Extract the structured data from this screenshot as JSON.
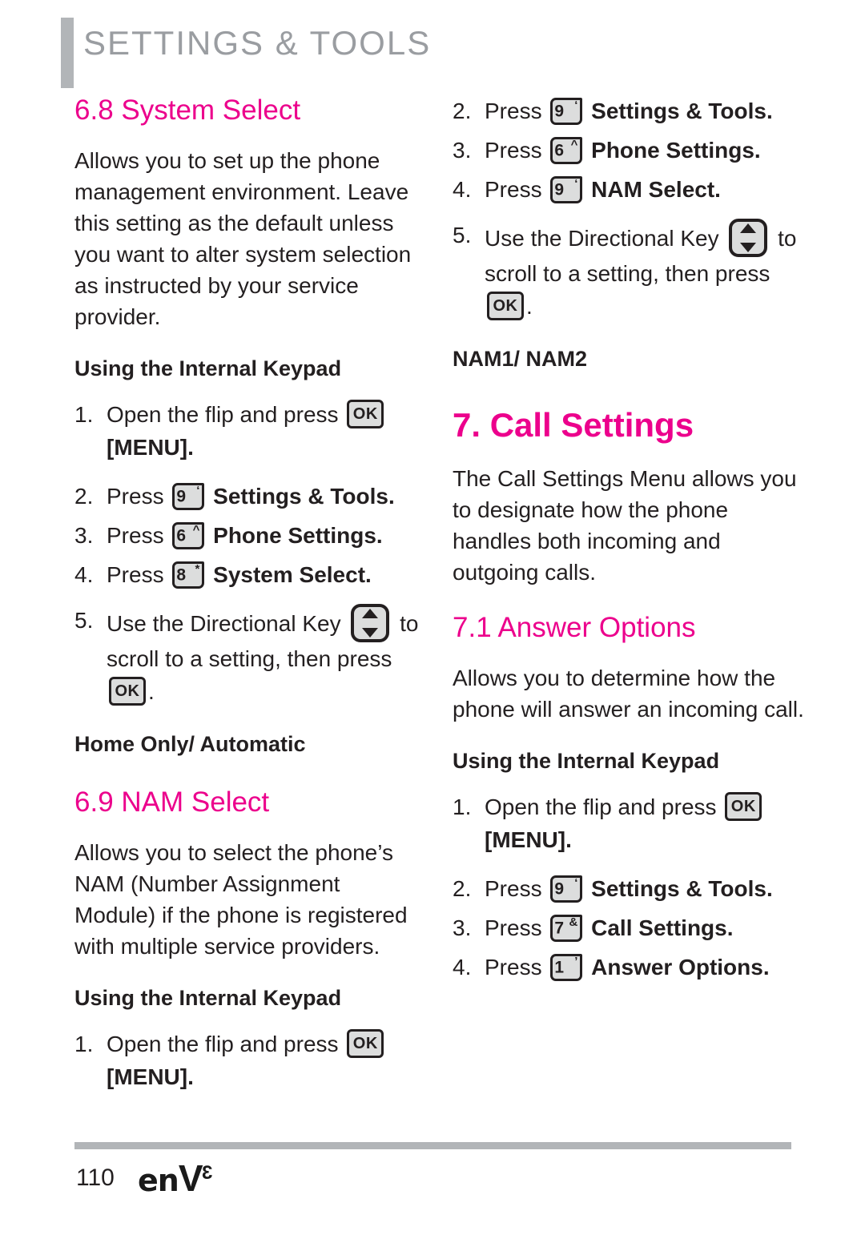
{
  "header": {
    "title": "SETTINGS & TOOLS",
    "accent_color": "#ec008c",
    "gray_color": "#9a9da1"
  },
  "left_column": {
    "section_6_8": {
      "heading": "6.8 System Select",
      "body": "Allows you to set up the phone management environment. Leave this setting as the default unless you want to alter system selection as instructed by your service provider.",
      "subhead": "Using the Internal Keypad",
      "steps": [
        {
          "num": "1.",
          "pre": "Open the flip and press ",
          "key": {
            "type": "ok",
            "label": "OK"
          },
          "post": "",
          "bold_after": "[MENU].",
          "wraps": true
        },
        {
          "num": "2.",
          "pre": "Press ",
          "key": {
            "type": "digit",
            "digit": "9",
            "sup": "‘"
          },
          "post": "Settings & Tools."
        },
        {
          "num": "3.",
          "pre": "Press ",
          "key": {
            "type": "digit",
            "digit": "6",
            "sup": "^"
          },
          "post": "Phone Settings."
        },
        {
          "num": "4.",
          "pre": "Press ",
          "key": {
            "type": "digit",
            "digit": "8",
            "sup": "*"
          },
          "post": "System Select."
        },
        {
          "num": "5.",
          "pre": "Use the Directional Key ",
          "key": {
            "type": "dir",
            "label": "directional-key"
          },
          "mid": " to scroll to a setting, then press ",
          "key2": {
            "type": "ok",
            "label": "OK"
          },
          "post": "."
        }
      ],
      "options": "Home Only/ Automatic"
    },
    "section_6_9": {
      "heading": "6.9 NAM Select",
      "body": "Allows you to select the phone’s NAM (Number Assignment Module) if the phone is registered with multiple service providers.",
      "subhead": "Using the Internal Keypad",
      "steps": [
        {
          "num": "1.",
          "pre": "Open the flip and press ",
          "key": {
            "type": "ok",
            "label": "OK"
          },
          "bold_after": "[MENU]."
        }
      ]
    }
  },
  "right_column": {
    "section_6_9_cont": {
      "steps": [
        {
          "num": "2.",
          "pre": "Press ",
          "key": {
            "type": "digit",
            "digit": "9",
            "sup": "‘"
          },
          "post": "Settings & Tools."
        },
        {
          "num": "3.",
          "pre": "Press ",
          "key": {
            "type": "digit",
            "digit": "6",
            "sup": "^"
          },
          "post": "Phone Settings."
        },
        {
          "num": "4.",
          "pre": "Press ",
          "key": {
            "type": "digit",
            "digit": "9",
            "sup": "‘"
          },
          "post": "NAM Select."
        },
        {
          "num": "5.",
          "pre": "Use the Directional Key ",
          "key": {
            "type": "dir",
            "label": "directional-key"
          },
          "mid": " to scroll to a setting, then press ",
          "key2": {
            "type": "ok",
            "label": "OK"
          },
          "post": "."
        }
      ],
      "options": "NAM1/ NAM2"
    },
    "section_7": {
      "heading": "7. Call Settings",
      "body": "The Call Settings Menu allows you to designate how the phone handles both incoming and outgoing calls."
    },
    "section_7_1": {
      "heading": "7.1 Answer Options",
      "body": "Allows you to determine how the phone will answer an incoming call.",
      "subhead": "Using the Internal Keypad",
      "steps": [
        {
          "num": "1.",
          "pre": "Open the flip and press ",
          "key": {
            "type": "ok",
            "label": "OK"
          },
          "bold_after": "[MENU]."
        },
        {
          "num": "2.",
          "pre": "Press ",
          "key": {
            "type": "digit",
            "digit": "9",
            "sup": "‘"
          },
          "post": "Settings & Tools."
        },
        {
          "num": "3.",
          "pre": "Press ",
          "key": {
            "type": "digit",
            "digit": "7",
            "sup": "&"
          },
          "post": "Call Settings."
        },
        {
          "num": "4.",
          "pre": "Press ",
          "key": {
            "type": "digit",
            "digit": "1",
            "sup": "’"
          },
          "post": "Answer Options."
        }
      ]
    }
  },
  "footer": {
    "page_number": "110",
    "logo_en": "en",
    "logo_v": "V",
    "logo_sup": "3"
  }
}
